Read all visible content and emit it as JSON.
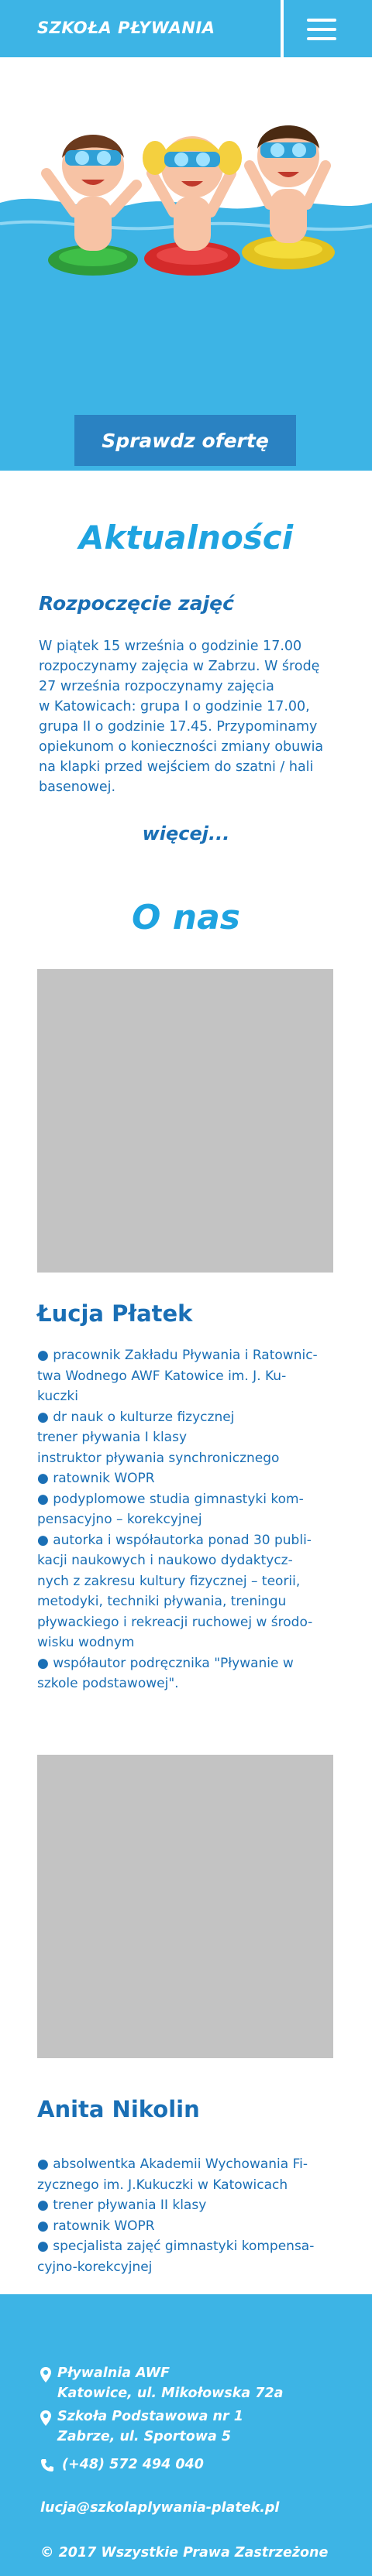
{
  "header": {
    "brand": "SZKOŁA PŁYWANIA"
  },
  "hero": {
    "offer_button": "Sprawdz ofertę"
  },
  "news": {
    "title": "Aktualności",
    "subtitle": "Rozpoczęcie zajęć",
    "lines": [
      "W piątek 15 września o godzinie 17.00",
      "rozpoczynamy zajęcia w Zabrzu. W środę",
      "27 września rozpoczynamy zajęcia",
      "w Katowicach: grupa I o godzinie 17.00,",
      "grupa II o godzinie 17.45. Przypominamy",
      "opiekunom o konieczności zmiany obuwia",
      "na klapki przed wejściem do szatni / hali",
      "basenowej."
    ],
    "more": "więcej..."
  },
  "about": {
    "title": "O nas",
    "people": [
      {
        "name": "Łucja Płatek",
        "lines": [
          "● pracownik Zakładu Pływania i Ratownic-",
          "twa Wodnego AWF Katowice im. J. Ku-",
          "kuczki",
          "● dr nauk o kulturze fizycznej",
          "trener pływania I klasy",
          "instruktor pływania synchronicznego",
          "● ratownik WOPR",
          "● podyplomowe studia gimnastyki kom-",
          "pensacyjno – korekcyjnej",
          "● autorka i współautorka ponad 30 publi-",
          "kacji naukowych i naukowo dydaktycz-",
          "nych z zakresu kultury fizycznej – teorii,",
          "metodyki, techniki pływania, treningu",
          "pływackiego i rekreacji ruchowej w środo-",
          "wisku wodnym",
          "● współautor podręcznika \"Pływanie w",
          "szkole podstawowej\"."
        ]
      },
      {
        "name": "Anita Nikolin",
        "lines": [
          "● absolwentka Akademii Wychowania Fi-",
          "zycznego im. J.Kukuczki w Katowicach",
          "● trener pływania II klasy",
          "● ratownik WOPR",
          "● specjalista zajęć gimnastyki kompensa-",
          "cyjno-korekcyjnej"
        ]
      }
    ]
  },
  "footer": {
    "address1_name": "Pływalnia AWF",
    "address1_street": "Katowice, ul. Mikołowska 72a",
    "address2_name": "Szkoła Podstawowa nr 1",
    "address2_street": "Zabrze, ul. Sportowa 5",
    "phone": "(+48) 572 494 040",
    "email": "lucja@szkolaplywania-platek.pl",
    "copyright": "© 2017 Wszystkie Prawa Zastrzeżone"
  },
  "colors": {
    "primary": "#3db4e5",
    "button": "#2a82c2",
    "text": "#1a6fb5",
    "heading": "#1ea3e0"
  },
  "icons": {
    "menu": "hamburger-icon",
    "location": "location-pin-icon",
    "phone": "phone-icon"
  }
}
